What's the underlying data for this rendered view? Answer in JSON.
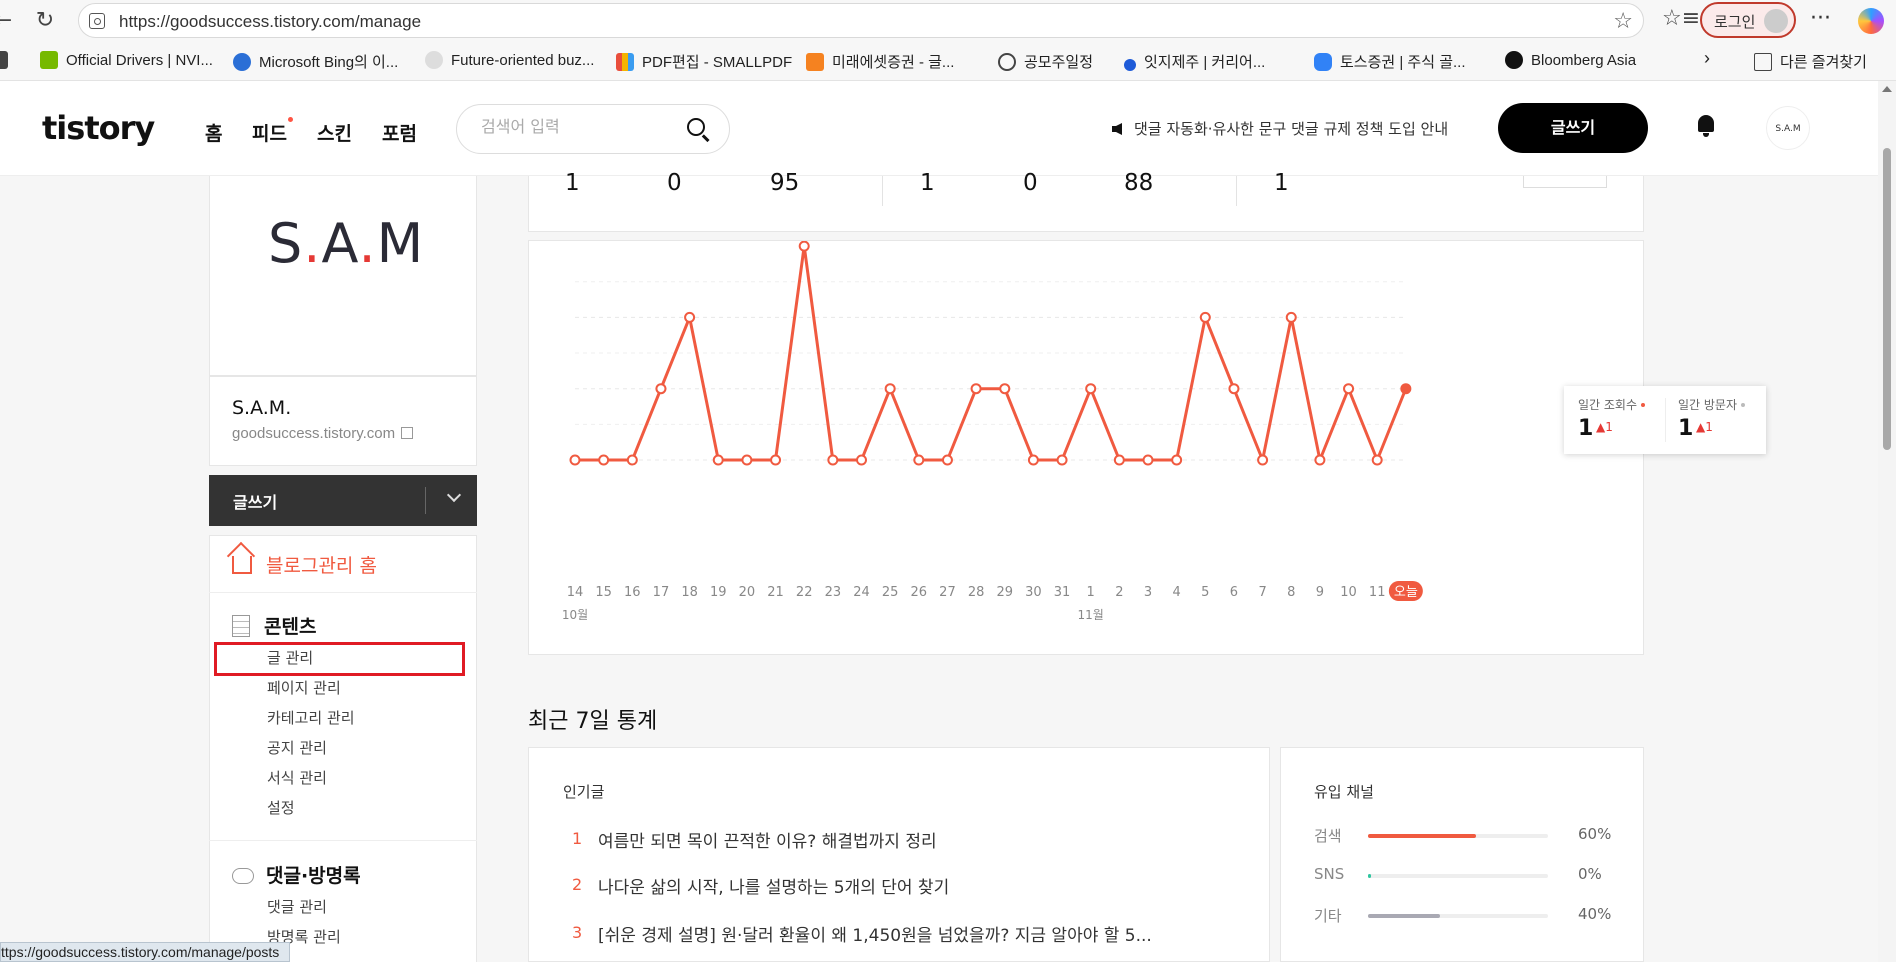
{
  "browser": {
    "url": "https://goodsuccess.tistory.com/manage",
    "login_label": "로그인",
    "more_label": "···",
    "bookmarks": [
      {
        "label": "Official Drivers | NVI...",
        "icon": "nvidia-icon",
        "color": "#76b900"
      },
      {
        "label": "Microsoft Bing의 이...",
        "icon": "bing-search-icon",
        "color": "#2b6fd6"
      },
      {
        "label": "Future-oriented buz...",
        "icon": "openai-icon",
        "color": "#bbbbbb"
      },
      {
        "label": "PDF편집 - SMALLPDF",
        "icon": "smallpdf-icon",
        "color": "#e94e3c"
      },
      {
        "label": "미래에셋증권 - 글...",
        "icon": "mirae-asset-icon",
        "color": "#f58220"
      },
      {
        "label": "공모주일정",
        "icon": "globe-icon",
        "color": "#444444"
      },
      {
        "label": "잇지제주 | 커리어...",
        "icon": "itji-icon",
        "color": "#1e5bd8"
      },
      {
        "label": "토스증권 | 주식 골...",
        "icon": "toss-icon",
        "color": "#3182f6"
      },
      {
        "label": "Bloomberg Asia",
        "icon": "bloomberg-icon",
        "color": "#111111"
      }
    ],
    "other_bookmarks": "다른 즐겨찾기",
    "status_url": "ttps://goodsuccess.tistory.com/manage/posts"
  },
  "header": {
    "logo": "tistory",
    "nav": [
      "홈",
      "피드",
      "스킨",
      "포럼"
    ],
    "search_placeholder": "검색어 입력",
    "notice": "댓글 자동화·유사한 문구 댓글 규제 정책 도입 안내",
    "write_label": "글쓰기",
    "avatar_text": "S.A.M"
  },
  "sidebar": {
    "logo_text_a": "S",
    "logo_text_b": "A",
    "logo_text_c": "M",
    "blog_name": "S.A.M.",
    "blog_url": "goodsuccess.tistory.com",
    "write_label": "글쓰기",
    "home_label": "블로그관리 홈",
    "content_title": "콘텐츠",
    "content_items": [
      "글 관리",
      "페이지 관리",
      "카테고리 관리",
      "공지 관리",
      "서식 관리",
      "설정"
    ],
    "comments_title": "댓글·방명록",
    "comment_items": [
      "댓글 관리",
      "방명록 관리"
    ]
  },
  "stats_row": [
    "1",
    "0",
    "95",
    "1",
    "0",
    "88",
    "1"
  ],
  "chart_data": {
    "type": "line",
    "categories": [
      "14",
      "15",
      "16",
      "17",
      "18",
      "19",
      "20",
      "21",
      "22",
      "23",
      "24",
      "25",
      "26",
      "27",
      "28",
      "29",
      "30",
      "31",
      "1",
      "2",
      "3",
      "4",
      "5",
      "6",
      "7",
      "8",
      "9",
      "10",
      "11",
      "오늘"
    ],
    "month_labels": [
      {
        "at": "14",
        "label": "10월"
      },
      {
        "at": "1",
        "label": "11월"
      }
    ],
    "series": [
      {
        "color": "#f05a40",
        "values": [
          0,
          0,
          0,
          1,
          2,
          0,
          0,
          0,
          3,
          0,
          0,
          1,
          0,
          0,
          1,
          1,
          0,
          0,
          1,
          0,
          0,
          0,
          2,
          1,
          0,
          2,
          0,
          1,
          0,
          1
        ]
      }
    ],
    "ylim": [
      0,
      3.3
    ],
    "grid": true
  },
  "tooltip": {
    "views_label": "일간 조회수",
    "visitors_label": "일간 방문자",
    "views_value": "1",
    "views_delta": "▲1",
    "visitors_value": "1",
    "visitors_delta": "▲1"
  },
  "recent": {
    "title": "최근 7일 통계",
    "popular_title": "인기글",
    "popular": [
      {
        "rank": "1",
        "title": "여름만 되면 목이 끈적한 이유? 해결법까지 정리"
      },
      {
        "rank": "2",
        "title": "나다운 삶의 시작, 나를 설명하는 5개의 단어 찾기"
      },
      {
        "rank": "3",
        "title": "[쉬운 경제 설명] 원·달러 환율이 왜 1,450원을 넘었을까? 지금 알아야 할 5..."
      }
    ],
    "channel_title": "유입 채널",
    "channels": [
      {
        "label": "검색",
        "value": 60,
        "pct": "60%",
        "color": "#f05a40"
      },
      {
        "label": "SNS",
        "value": 0,
        "pct": "0%",
        "color": "#2fc6a0"
      },
      {
        "label": "기타",
        "value": 40,
        "pct": "40%",
        "color": "#a9a9b3"
      }
    ]
  }
}
